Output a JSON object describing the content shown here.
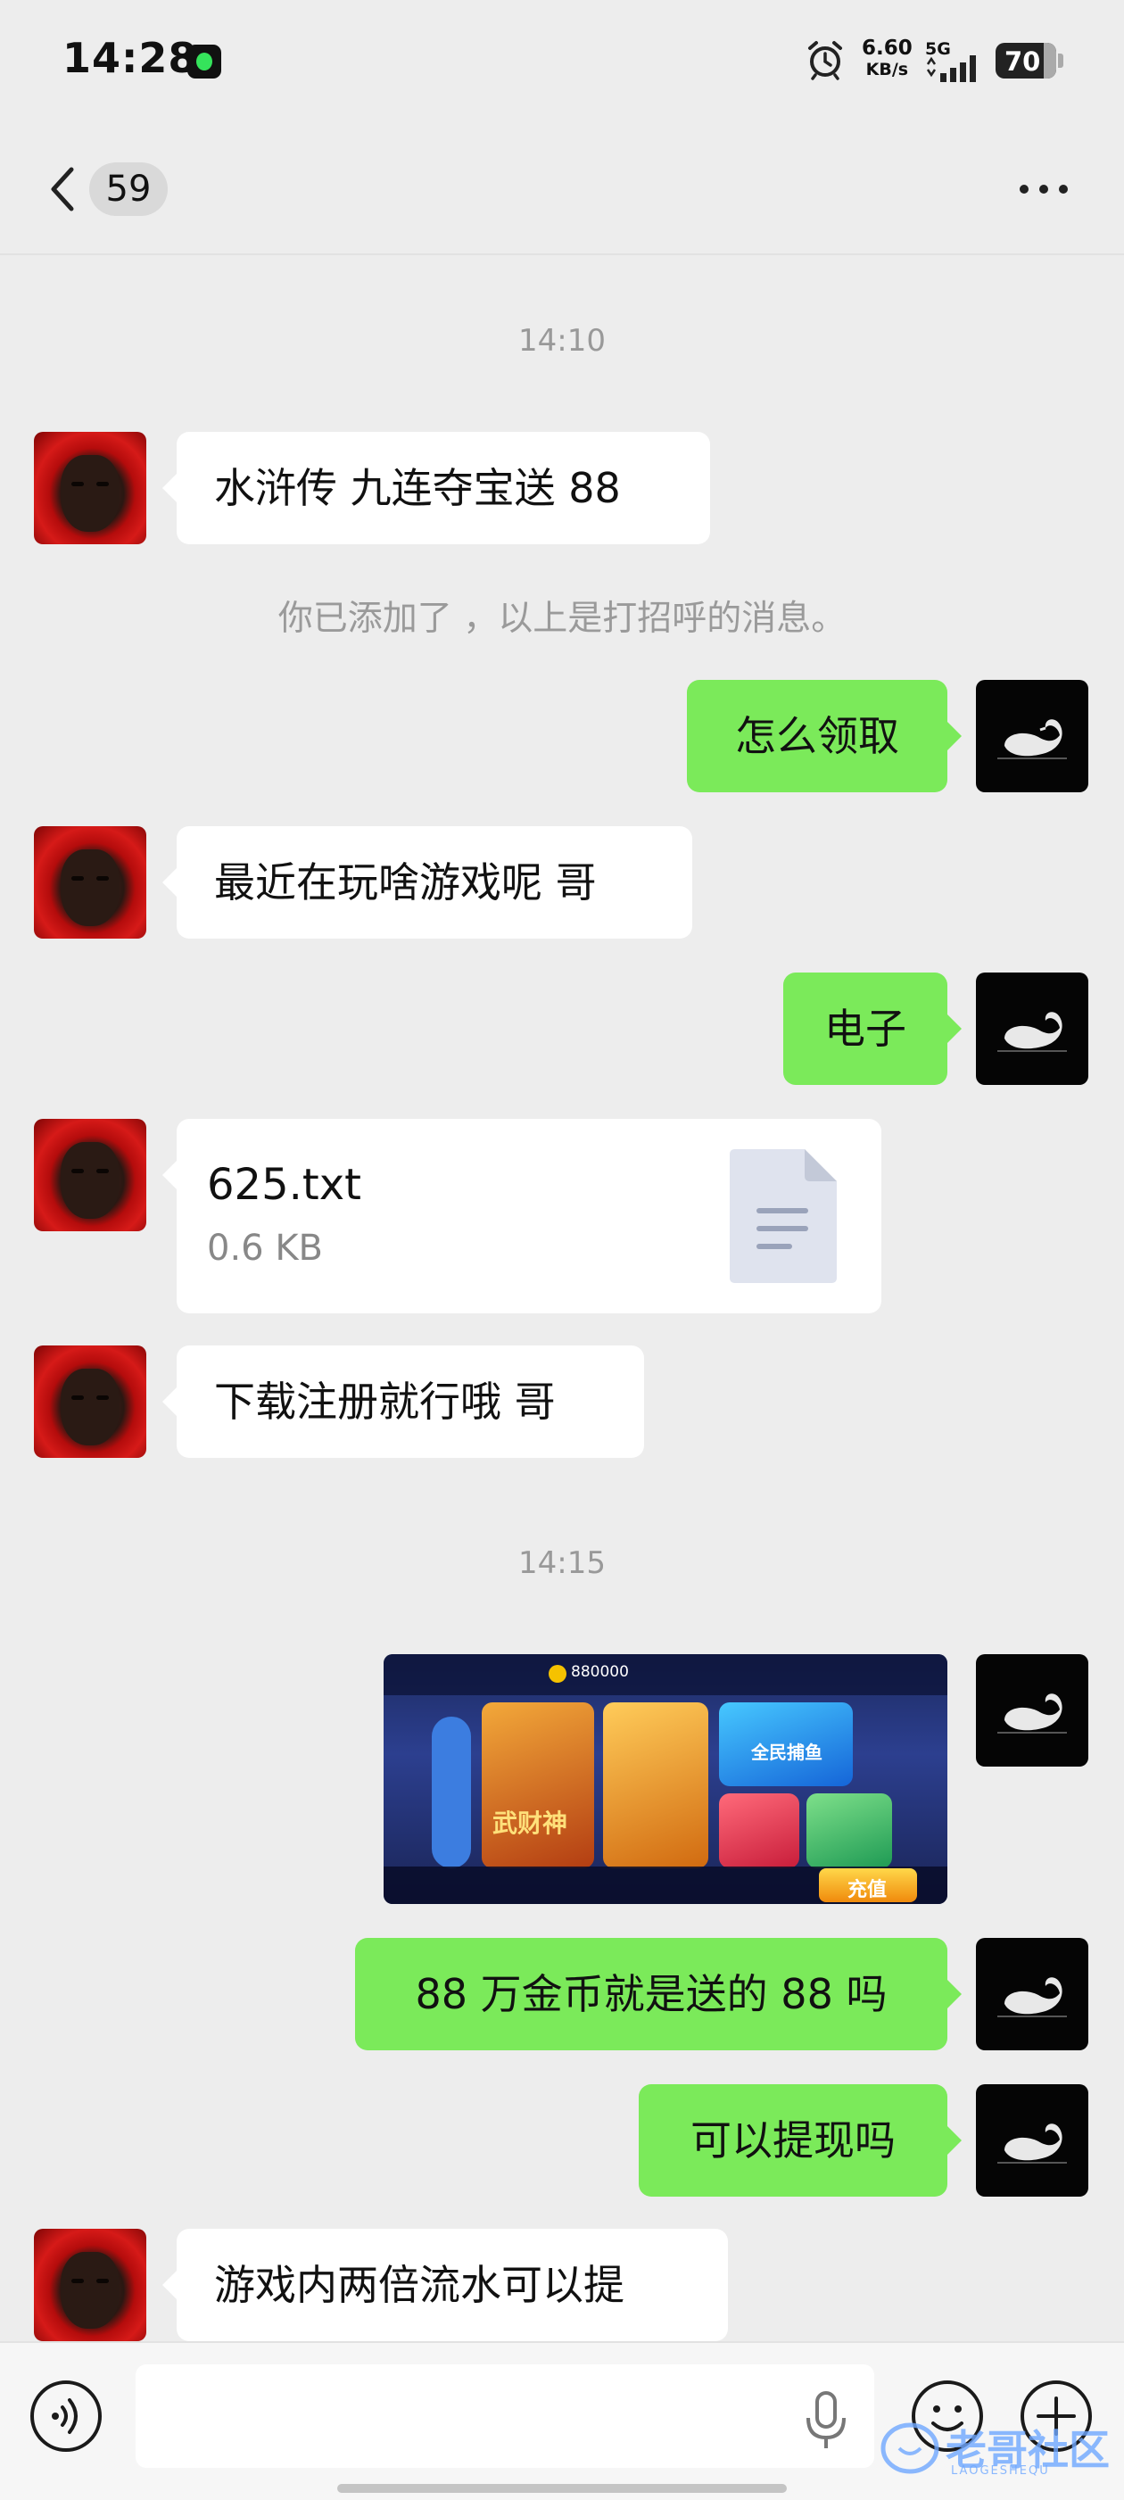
{
  "status_bar": {
    "time": "14:28",
    "net_speed_value": "6.60",
    "net_speed_unit": "KB/s",
    "network": "5G",
    "battery": "70"
  },
  "header": {
    "unread_count": "59"
  },
  "messages": {
    "time_1": "14:10",
    "m1": "水浒传 九连夺宝送 88",
    "system_notice": "你已添加了 ，以上是打招呼的消息。",
    "m2": "怎么领取",
    "m3": "最近在玩啥游戏呢 哥",
    "m4": "电子",
    "file_name": "625.txt",
    "file_size": "0.6 KB",
    "m5": "下载注册就行哦 哥",
    "time_2": "14:15",
    "image_caption_coins": "880000",
    "image_tile_1": "武财神",
    "image_tile_3": "全民捕鱼",
    "image_charge": "充值",
    "m6": "88 万金币就是送的 88 吗",
    "m7": "可以提现吗",
    "m8": "游戏内两倍流水可以提"
  },
  "input_bar": {
    "placeholder": ""
  },
  "watermark": {
    "text": "老哥社区",
    "sub": "LAOGESHEQU"
  }
}
